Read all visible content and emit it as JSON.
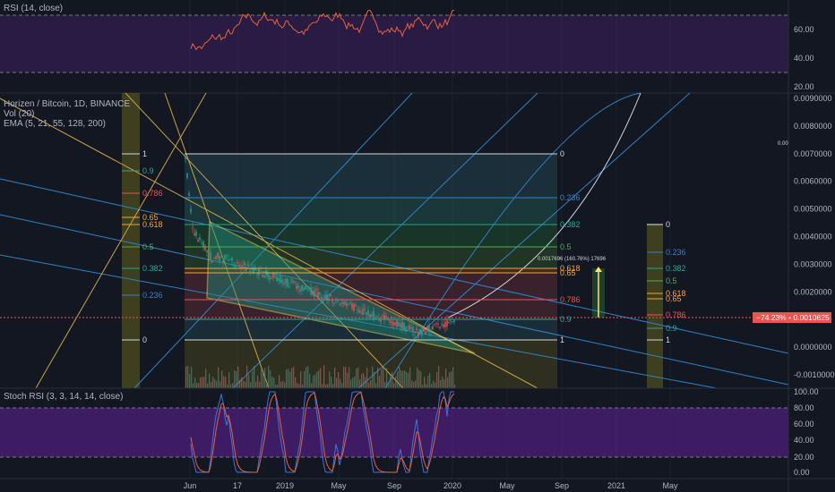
{
  "colors": {
    "background": "#131722",
    "grid": "#2a2e39",
    "purple_band": "#3c1f5e",
    "rsi_line": "#e8613c",
    "stoch_k": "#3d74d8",
    "stoch_d": "#e8613c",
    "price_badge": "#ef5350",
    "fib_white": "#d1d4dc",
    "fib_teal": "#26a69a",
    "fib_red": "#ef5350",
    "fib_orange": "#f4a340",
    "fib_green": "#4caf50",
    "wedge": "#f5e663",
    "trend_blue": "#2f82c5"
  },
  "rsi_pane": {
    "title": "RSI (14, close)",
    "axis_ticks": [
      "60.00",
      "40.00",
      "20.00"
    ]
  },
  "main_pane": {
    "symbol_line": "Horizen / Bitcoin, 1D, BINANCE",
    "vol_line": "Vol (20)",
    "ema_line": "EMA (5, 21, 55, 128, 200)",
    "axis_ticks": [
      "0.0090000",
      "0.0080000",
      "0.0070000",
      "0.0060000",
      "0.0050000",
      "0.0040000",
      "0.0030000",
      "0.0020000",
      "0.0010000",
      "0.0000000",
      "-0.0010000"
    ],
    "price_badge": "−74.23% • 0.0010625",
    "small_edge_label": "0.00",
    "measure_label": "0.0017696 (160.76%) 17696",
    "fib_left": [
      "1",
      "0.9",
      "0.786",
      "0.65",
      "0.618",
      "0.5",
      "0.382",
      "0.236",
      "0"
    ],
    "fib_big": [
      "0",
      "0.236",
      "0.382",
      "0.5",
      "0.618",
      "0.65",
      "0.786",
      "0.9",
      "1"
    ],
    "fib_right": [
      "0",
      "0.236",
      "0.382",
      "0.5",
      "0.618",
      "0.65",
      "0.786",
      "0.9",
      "1"
    ]
  },
  "stoch_pane": {
    "title": "Stoch RSI (3, 3, 14, 14, close)",
    "axis_ticks": [
      "100.00",
      "80.00",
      "60.00",
      "40.00",
      "20.00",
      "0.00"
    ]
  },
  "time_axis": [
    "Jun",
    "17",
    "2019",
    "May",
    "Sep",
    "2020",
    "May",
    "Sep",
    "2021",
    "May"
  ]
}
